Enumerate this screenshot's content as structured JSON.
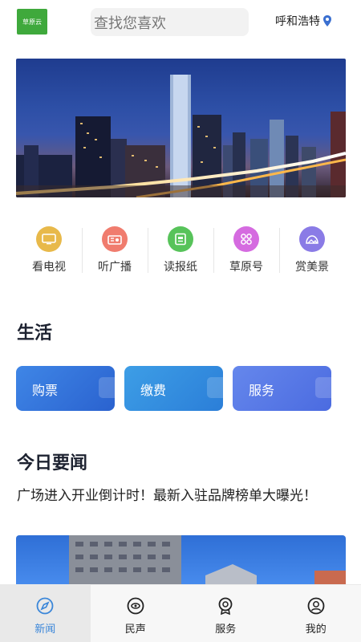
{
  "header": {
    "logo_text": "草原云",
    "search_placeholder": "查找您喜欢",
    "location": "呼和浩特",
    "location_icon": "map-pin-icon"
  },
  "banner": {
    "description_icon": "city-skyline-photo"
  },
  "quick_nav": [
    {
      "label": "看电视",
      "icon": "tv-icon",
      "color": "#e8b94a"
    },
    {
      "label": "听广播",
      "icon": "radio-icon",
      "color": "#f07c6e"
    },
    {
      "label": "读报纸",
      "icon": "newspaper-icon",
      "color": "#57c35a"
    },
    {
      "label": "草原号",
      "icon": "grid-icon",
      "color": "#d56be0"
    },
    {
      "label": "赏美景",
      "icon": "landscape-icon",
      "color": "#8a7be6"
    }
  ],
  "life": {
    "title": "生活",
    "cards": [
      {
        "label": "购票",
        "color_from": "#3b7de0",
        "color_to": "#2c6ad6"
      },
      {
        "label": "缴费",
        "color_from": "#3a95e0",
        "color_to": "#2b7fd8"
      },
      {
        "label": "服务",
        "color_from": "#5b7ee8",
        "color_to": "#4a6fe0"
      }
    ]
  },
  "news": {
    "title": "今日要闻",
    "headline": "广场进入开业倒计时！最新入驻品牌榜单大曝光！"
  },
  "tabbar": [
    {
      "label": "新闻",
      "icon": "news-compass-icon",
      "active": true
    },
    {
      "label": "民声",
      "icon": "voice-icon",
      "active": false
    },
    {
      "label": "服务",
      "icon": "service-badge-icon",
      "active": false
    },
    {
      "label": "我的",
      "icon": "profile-icon",
      "active": false
    }
  ],
  "colors": {
    "accent": "#3a86d9",
    "logo_green": "#3fa93c"
  }
}
